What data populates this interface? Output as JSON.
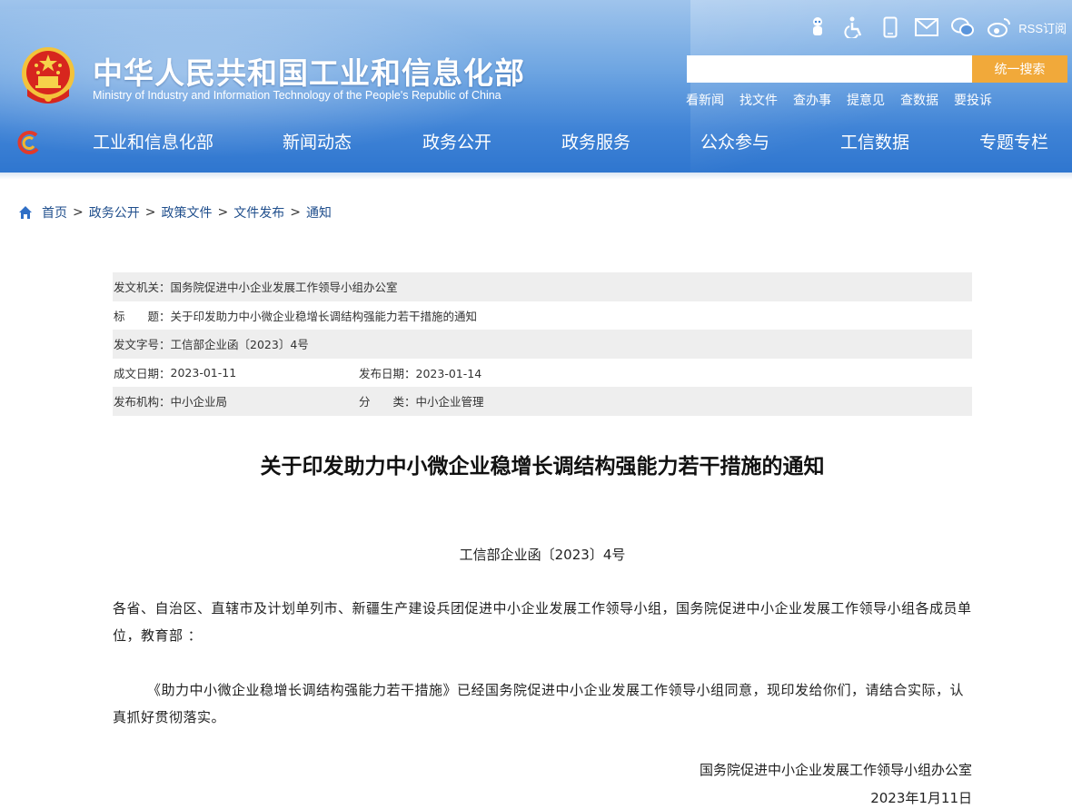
{
  "header": {
    "site_title": "中华人民共和国工业和信息化部",
    "site_subtitle": "Ministry of Industry and Information Technology of the People's Republic of China",
    "top_icons": [
      "robot-icon",
      "accessibility-icon",
      "mobile-icon",
      "mail-icon",
      "wechat-icon",
      "weibo-icon"
    ],
    "rss_label": "RSS订阅",
    "search": {
      "placeholder": "",
      "button_label": "统一搜索"
    },
    "quick_links": [
      "看新闻",
      "找文件",
      "查办事",
      "提意见",
      "查数据",
      "要投诉"
    ],
    "nav": [
      "工业和信息化部",
      "新闻动态",
      "政务公开",
      "政务服务",
      "公众参与",
      "工信数据",
      "专题专栏"
    ],
    "colors": {
      "header_blue": "#3f83d6",
      "search_button": "#f1a93a"
    }
  },
  "breadcrumb": [
    "首页",
    "政务公开",
    "政策文件",
    "文件发布",
    "通知"
  ],
  "meta": {
    "issuer_label": "发文机关：",
    "issuer": "国务院促进中小企业发展工作领导小组办公室",
    "title_label": "标　　题：",
    "title": "关于印发助力中小微企业稳增长调结构强能力若干措施的通知",
    "doc_no_label": "发文字号：",
    "doc_no": "工信部企业函〔2023〕4号",
    "created_label": "成文日期：",
    "created": "2023-01-11",
    "published_label": "发布日期：",
    "published": "2023-01-14",
    "org_label": "发布机构：",
    "org": "中小企业局",
    "category_label": "分　　类：",
    "category": "中小企业管理"
  },
  "article": {
    "title": "关于印发助力中小微企业稳增长调结构强能力若干措施的通知",
    "doc_number": "工信部企业函〔2023〕4号",
    "recipients": "各省、自治区、直辖市及计划单列市、新疆生产建设兵团促进中小企业发展工作领导小组，国务院促进中小企业发展工作领导小组各成员单位，教育部 ：",
    "body": "《助力中小微企业稳增长调结构强能力若干措施》已经国务院促进中小企业发展工作领导小组同意，现印发给你们，请结合实际，认真抓好贯彻落实。",
    "signer": "国务院促进中小企业发展工作领导小组办公室",
    "date": "2023年1月11日"
  }
}
